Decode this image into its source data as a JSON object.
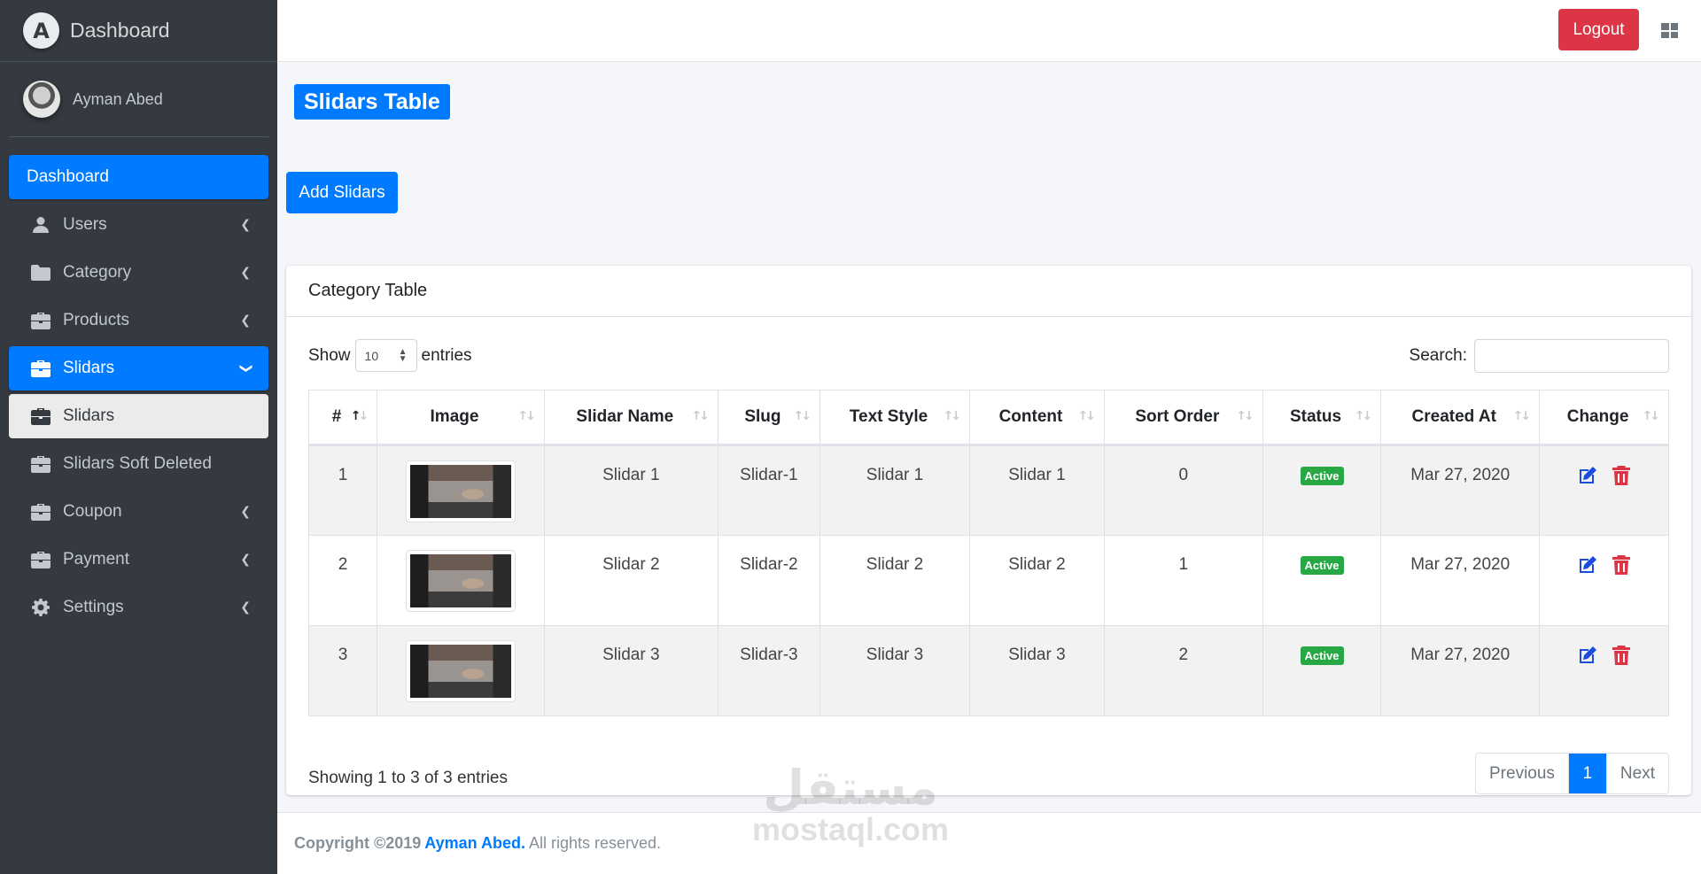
{
  "brand": {
    "logo_letter": "A",
    "title": "Dashboard"
  },
  "user": {
    "name": "Ayman Abed"
  },
  "sidebar": {
    "items": [
      {
        "label": "Dashboard",
        "icon": "none"
      },
      {
        "label": "Users",
        "icon": "user-icon"
      },
      {
        "label": "Category",
        "icon": "folder-icon"
      },
      {
        "label": "Products",
        "icon": "briefcase-icon"
      },
      {
        "label": "Slidars",
        "icon": "briefcase-icon"
      },
      {
        "label": "Slidars",
        "icon": "briefcase-icon"
      },
      {
        "label": "Slidars Soft Deleted",
        "icon": "briefcase-icon"
      },
      {
        "label": "Coupon",
        "icon": "briefcase-icon"
      },
      {
        "label": "Payment",
        "icon": "briefcase-icon"
      },
      {
        "label": "Settings",
        "icon": "gear-icon"
      }
    ]
  },
  "topbar": {
    "logout_label": "Logout"
  },
  "page": {
    "title": "Slidars Table",
    "add_button": "Add Slidars"
  },
  "card": {
    "title": "Category Table",
    "show_label": "Show",
    "entries_value": "10",
    "entries_label": "entries",
    "search_label": "Search:",
    "search_value": "",
    "columns": [
      "#",
      "Image",
      "Slidar Name",
      "Slug",
      "Text Style",
      "Content",
      "Sort Order",
      "Status",
      "Created At",
      "Change"
    ],
    "rows": [
      {
        "num": "1",
        "name": "Slidar 1",
        "slug": "Slidar-1",
        "text_style": "Slidar 1",
        "content": "Slidar 1",
        "sort": "0",
        "status": "Active",
        "created": "Mar 27, 2020"
      },
      {
        "num": "2",
        "name": "Slidar 2",
        "slug": "Slidar-2",
        "text_style": "Slidar 2",
        "content": "Slidar 2",
        "sort": "1",
        "status": "Active",
        "created": "Mar 27, 2020"
      },
      {
        "num": "3",
        "name": "Slidar 3",
        "slug": "Slidar-3",
        "text_style": "Slidar 3",
        "content": "Slidar 3",
        "sort": "2",
        "status": "Active",
        "created": "Mar 27, 2020"
      }
    ],
    "info": "Showing 1 to 3 of 3 entries",
    "pager": {
      "previous": "Previous",
      "current": "1",
      "next": "Next"
    }
  },
  "footer": {
    "copyright": "Copyright ©2019",
    "author": "Ayman Abed.",
    "rights": "All rights reserved."
  },
  "watermark": {
    "arabic": "مستقل",
    "latin": "mostaql.com"
  },
  "colors": {
    "primary": "#007bff",
    "danger": "#dc3545",
    "success": "#28a745",
    "sidebar": "#343a40"
  }
}
